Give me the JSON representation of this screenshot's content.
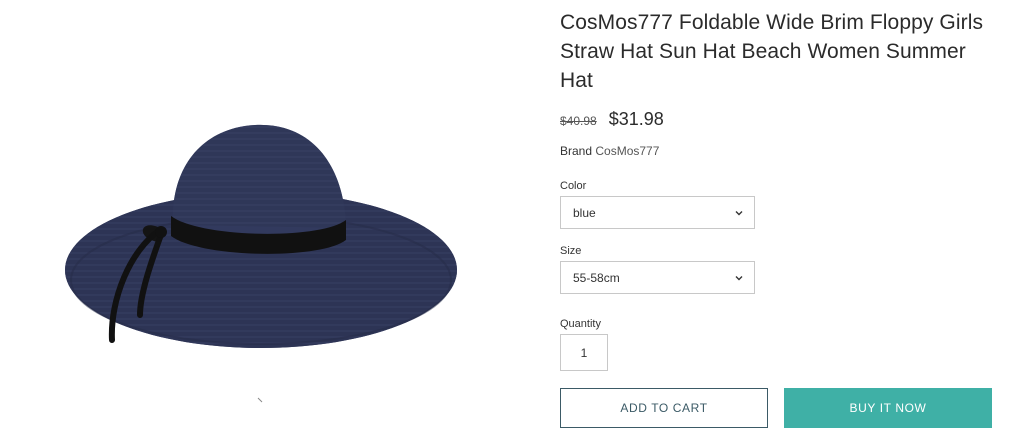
{
  "product": {
    "title": "CosMos777 Foldable Wide Brim Floppy Girls Straw Hat Sun Hat Beach Women Summer Hat",
    "old_price": "$40.98",
    "price": "$31.98",
    "brand_label": "Brand",
    "brand_name": "CosMos777"
  },
  "options": {
    "color_label": "Color",
    "color_value": "blue",
    "size_label": "Size",
    "size_value": "55-58cm",
    "quantity_label": "Quantity",
    "quantity_value": "1"
  },
  "actions": {
    "add_to_cart": "ADD TO CART",
    "buy_now": "BUY IT NOW"
  },
  "colors": {
    "accent": "#3fb0a6",
    "outline": "#3b5a66",
    "hat": "#2f3656"
  },
  "icons": {
    "dropdown": "chevron-down-icon"
  }
}
